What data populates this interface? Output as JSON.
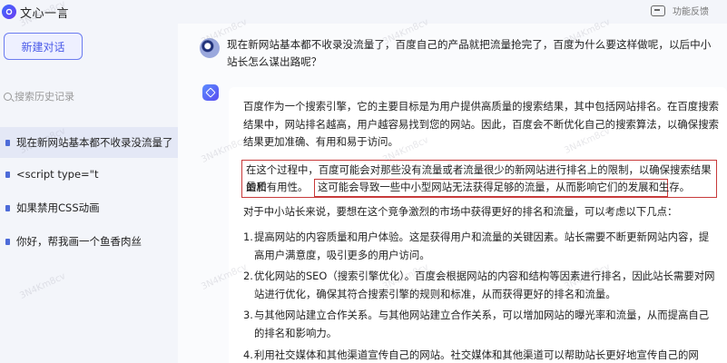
{
  "app": {
    "title": "文心一言",
    "feedback_label": "功能反馈"
  },
  "sidebar": {
    "new_chat_label": "新建对话",
    "search_placeholder": "搜索历史记录",
    "items": [
      {
        "label": "现在新网站基本都不收录没流量了"
      },
      {
        "label": "<script type=\"t"
      },
      {
        "label": "如果禁用CSS动画"
      },
      {
        "label": "你好，帮我画一个鱼香肉丝"
      }
    ]
  },
  "conversation": {
    "user_message": "现在新网站基本都不收录没流量了，百度自己的产品就把流量抢完了，百度为什么要这样做呢，以后中小站长怎么谋出路呢？",
    "bot": {
      "para1": "百度作为一个搜索引擎，它的主要目标是为用户提供高质量的搜索结果，其中包括网站排名。在百度搜索结果中，网站排名越高，用户越容易找到您的网站。因此，百度会不断优化自己的搜索算法，以确保搜索结果更加准确、有用和易于访问。",
      "para2_line1": "在这个过程中，百度可能会对那些没有流量或者流量很少的新网站进行排名上的限制，以确保搜索结果的质",
      "para2_line2a": "量和有用性。",
      "para2_line2b": "这可能会导致一些中小型网站无法获得足够的流量，从而影响它们的发展和生存。",
      "para3": "对于中小站长来说，要想在这个竞争激烈的市场中获得更好的排名和流量，可以考虑以下几点：",
      "list": [
        {
          "num": "1.",
          "text": "提高网站的内容质量和用户体验。这是获得用户和流量的关键因素。站长需要不断更新网站内容，提高用户满意度，吸引更多的用户访问。"
        },
        {
          "num": "2.",
          "text": "优化网站的SEO（搜索引擎优化）。百度会根据网站的内容和结构等因素进行排名，因此站长需要对网站进行优化，确保其符合搜索引擎的规则和标准，从而获得更好的排名和流量。"
        },
        {
          "num": "3.",
          "text": "与其他网站建立合作关系。与其他网站建立合作关系，可以增加网站的曝光率和流量，从而提高自己的排名和影响力。"
        },
        {
          "num": "4.",
          "text": "利用社交媒体和其他渠道宣传自己的网站。社交媒体和其他渠道可以帮助站长更好地宣传自己的网"
        }
      ]
    }
  },
  "watermark": "3N4Km8cv",
  "colors": {
    "accent": "#4a5ae8",
    "highlight_border": "#c83a3a"
  }
}
